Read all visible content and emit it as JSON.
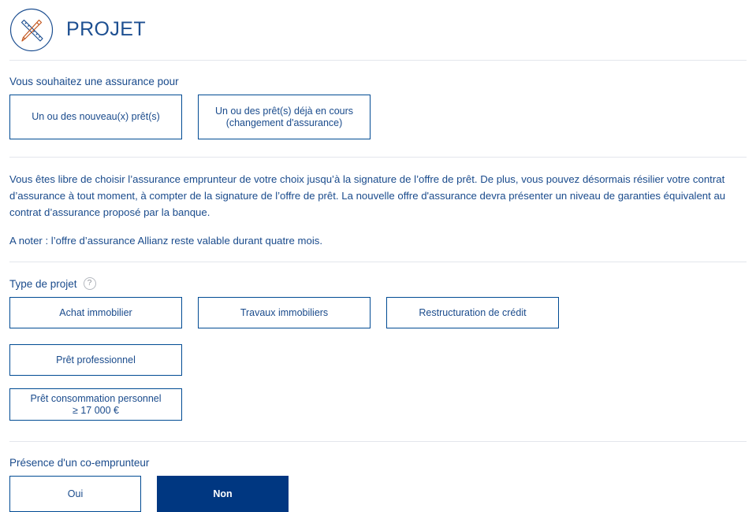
{
  "header": {
    "title": "PROJET",
    "icon": "pencil-ruler-icon"
  },
  "insurance_for": {
    "label": "Vous souhaitez une assurance pour",
    "options": [
      {
        "label": "Un ou des nouveau(x) prêt(s)",
        "selected": false
      },
      {
        "label": "Un ou des prêt(s) déjà en cours\n(changement d'assurance)",
        "line1": "Un ou des prêt(s) déjà en cours",
        "line2": "(changement d'assurance)",
        "selected": false
      }
    ]
  },
  "notice": {
    "paragraph1": "Vous êtes libre de choisir l’assurance emprunteur de votre choix jusqu’à la signature de l’offre de prêt. De plus, vous pouvez désormais résilier votre contrat d’assurance à tout moment, à compter de la signature de l’offre de prêt. La nouvelle offre d'assurance devra présenter un niveau de garanties équivalent au contrat d’assurance proposé par la banque.",
    "paragraph2": "A noter : l’offre d’assurance Allianz reste valable durant quatre mois."
  },
  "project_type": {
    "label": "Type de projet",
    "help_icon": "?",
    "options": [
      {
        "label": "Achat immobilier",
        "selected": false
      },
      {
        "label": "Travaux immobiliers",
        "selected": false
      },
      {
        "label": "Restructuration de crédit",
        "selected": false
      },
      {
        "label": "Prêt professionnel",
        "selected": false
      },
      {
        "line1": "Prêt consommation personnel",
        "line2": "≥ 17 000 €",
        "selected": false
      }
    ]
  },
  "co_borrower": {
    "label": "Présence d'un co-emprunteur",
    "options": [
      {
        "label": "Oui",
        "selected": false
      },
      {
        "label": "Non",
        "selected": true
      }
    ]
  },
  "colors": {
    "brand_blue": "#003781",
    "text_blue": "#1a4b8c",
    "title_blue": "#1d4f91",
    "divider_gray": "#e3e6ec",
    "help_gray": "#8d9199"
  }
}
